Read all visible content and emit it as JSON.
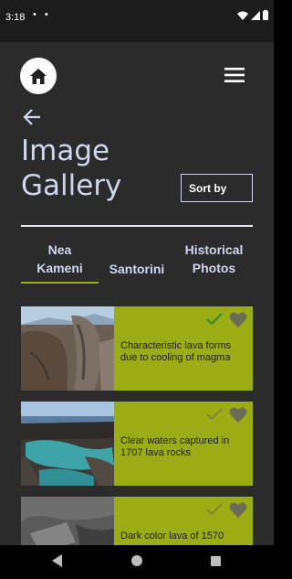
{
  "status_bar": {
    "time": "3:18",
    "notification_dots": "• •"
  },
  "header": {
    "home_icon": "home-icon",
    "menu_icon": "hamburger-menu-icon",
    "back_icon": "arrow-left-icon"
  },
  "page": {
    "title": "Image Gallery",
    "sort_label": "Sort by"
  },
  "tabs": [
    {
      "label_line1": "Nea",
      "label_line2": "Kameni",
      "active": true
    },
    {
      "label_line1": "Santorini",
      "label_line2": "",
      "active": false
    },
    {
      "label_line1": "Historical",
      "label_line2": "Photos",
      "active": false
    }
  ],
  "gallery": [
    {
      "caption": "Characteristic lava forms due to cooling of magma",
      "checked": true,
      "favorite": false
    },
    {
      "caption": "Clear waters captured in 1707 lava rocks",
      "checked": false,
      "favorite": false
    },
    {
      "caption": "Dark color lava of 1570",
      "checked": false,
      "favorite": false
    }
  ],
  "colors": {
    "accent": "#9aad15",
    "background": "#2b2b2b",
    "title": "#d0d6ee",
    "check_active": "#3a8a2e",
    "check_inactive": "#7f8a2e",
    "heart": "#6b6b5a"
  }
}
